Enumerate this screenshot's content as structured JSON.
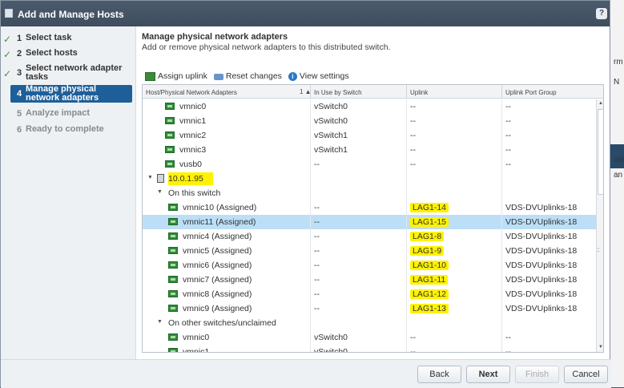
{
  "window": {
    "title": "Add and Manage Hosts",
    "help": "?"
  },
  "background_fragments": [
    "rm",
    "N",
    "ork",
    "an"
  ],
  "steps": [
    {
      "num": "1",
      "label": "Select task",
      "state": "done"
    },
    {
      "num": "2",
      "label": "Select hosts",
      "state": "done"
    },
    {
      "num": "3",
      "label": "Select network adapter tasks",
      "state": "done"
    },
    {
      "num": "4",
      "label": "Manage physical network adapters",
      "state": "active"
    },
    {
      "num": "5",
      "label": "Analyze impact",
      "state": "disabled"
    },
    {
      "num": "6",
      "label": "Ready to complete",
      "state": "disabled"
    }
  ],
  "main": {
    "title": "Manage physical network adapters",
    "subtitle": "Add or remove physical network adapters to this distributed switch."
  },
  "toolbar": {
    "assign_uplink": "Assign uplink",
    "reset_changes": "Reset changes",
    "view_settings": "View settings"
  },
  "grid": {
    "columns": [
      "Host/Physical Network Adapters",
      "In Use by Switch",
      "Uplink",
      "Uplink Port Group"
    ],
    "sort_indicator": "1 ▲",
    "rows": [
      {
        "kind": "nic",
        "name": "vmnic0",
        "switch": "vSwitch0",
        "uplink": "--",
        "group": "--"
      },
      {
        "kind": "nic",
        "name": "vmnic1",
        "switch": "vSwitch0",
        "uplink": "--",
        "group": "--"
      },
      {
        "kind": "nic",
        "name": "vmnic2",
        "switch": "vSwitch1",
        "uplink": "--",
        "group": "--"
      },
      {
        "kind": "nic",
        "name": "vmnic3",
        "switch": "vSwitch1",
        "uplink": "--",
        "group": "--"
      },
      {
        "kind": "nic",
        "name": "vusb0",
        "switch": "--",
        "uplink": "--",
        "group": "--"
      },
      {
        "kind": "host",
        "name": "10.0.1.95",
        "switch": "",
        "uplink": "",
        "group": ""
      },
      {
        "kind": "section",
        "name": "On this switch",
        "switch": "",
        "uplink": "",
        "group": ""
      },
      {
        "kind": "nic2",
        "name": "vmnic10 (Assigned)",
        "switch": "--",
        "uplink": "LAG1-14",
        "group": "VDS-DVUplinks-18"
      },
      {
        "kind": "nic2",
        "name": "vmnic11 (Assigned)",
        "switch": "--",
        "uplink": "LAG1-15",
        "group": "VDS-DVUplinks-18",
        "selected": true
      },
      {
        "kind": "nic2",
        "name": "vmnic4 (Assigned)",
        "switch": "--",
        "uplink": "LAG1-8",
        "group": "VDS-DVUplinks-18"
      },
      {
        "kind": "nic2",
        "name": "vmnic5 (Assigned)",
        "switch": "--",
        "uplink": "LAG1-9",
        "group": "VDS-DVUplinks-18"
      },
      {
        "kind": "nic2",
        "name": "vmnic6 (Assigned)",
        "switch": "--",
        "uplink": "LAG1-10",
        "group": "VDS-DVUplinks-18"
      },
      {
        "kind": "nic2",
        "name": "vmnic7 (Assigned)",
        "switch": "--",
        "uplink": "LAG1-11",
        "group": "VDS-DVUplinks-18"
      },
      {
        "kind": "nic2",
        "name": "vmnic8 (Assigned)",
        "switch": "--",
        "uplink": "LAG1-12",
        "group": "VDS-DVUplinks-18"
      },
      {
        "kind": "nic2",
        "name": "vmnic9 (Assigned)",
        "switch": "--",
        "uplink": "LAG1-13",
        "group": "VDS-DVUplinks-18"
      },
      {
        "kind": "section",
        "name": "On other switches/unclaimed",
        "switch": "",
        "uplink": "",
        "group": ""
      },
      {
        "kind": "nic2",
        "name": "vmnic0",
        "switch": "vSwitch0",
        "uplink": "--",
        "group": "--"
      },
      {
        "kind": "nic2",
        "name": "vmnic1",
        "switch": "vSwitch0",
        "uplink": "--",
        "group": "--"
      }
    ]
  },
  "buttons": {
    "back": "Back",
    "next": "Next",
    "finish": "Finish",
    "cancel": "Cancel"
  }
}
